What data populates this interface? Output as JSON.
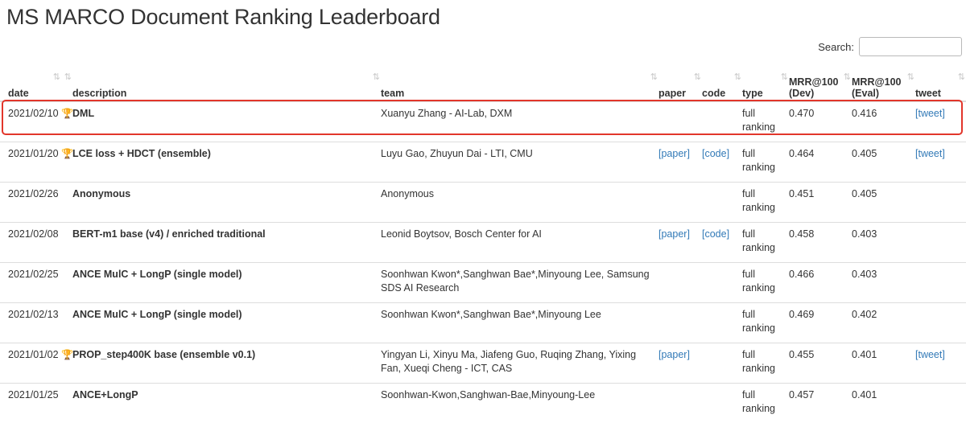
{
  "title": "MS MARCO Document Ranking Leaderboard",
  "search": {
    "label": "Search:",
    "value": "",
    "placeholder": ""
  },
  "columns": {
    "date": "date",
    "description": "description",
    "team": "team",
    "paper": "paper",
    "code": "code",
    "type": "type",
    "mrr_dev_1": "MRR@100",
    "mrr_dev_2": "(Dev)",
    "mrr_eval_1": "MRR@100",
    "mrr_eval_2": "(Eval)",
    "tweet": "tweet"
  },
  "sort_icon": "⇅",
  "rows": [
    {
      "date": "2021/02/10",
      "trophy": true,
      "description": "DML",
      "team": "Xuanyu Zhang - AI-Lab, DXM",
      "paper": "",
      "code": "",
      "type_1": "full",
      "type_2": "ranking",
      "dev": "0.470",
      "eval": "0.416",
      "tweet": "[tweet]"
    },
    {
      "date": "2021/01/20",
      "trophy": true,
      "description": "LCE loss + HDCT (ensemble)",
      "team": "Luyu Gao, Zhuyun Dai - LTI, CMU",
      "paper": "[paper]",
      "code": "[code]",
      "type_1": "full",
      "type_2": "ranking",
      "dev": "0.464",
      "eval": "0.405",
      "tweet": "[tweet]"
    },
    {
      "date": "2021/02/26",
      "trophy": false,
      "description": "Anonymous",
      "team": "Anonymous",
      "paper": "",
      "code": "",
      "type_1": "full",
      "type_2": "ranking",
      "dev": "0.451",
      "eval": "0.405",
      "tweet": ""
    },
    {
      "date": "2021/02/08",
      "trophy": false,
      "description": "BERT-m1 base (v4) / enriched traditional",
      "team": "Leonid Boytsov, Bosch Center for AI",
      "paper": "[paper]",
      "code": "[code]",
      "type_1": "full",
      "type_2": "ranking",
      "dev": "0.458",
      "eval": "0.403",
      "tweet": ""
    },
    {
      "date": "2021/02/25",
      "trophy": false,
      "description": "ANCE MulC + LongP (single model)",
      "team": "Soonhwan Kwon*,Sanghwan Bae*,Minyoung Lee, Samsung SDS AI Research",
      "paper": "",
      "code": "",
      "type_1": "full",
      "type_2": "ranking",
      "dev": "0.466",
      "eval": "0.403",
      "tweet": ""
    },
    {
      "date": "2021/02/13",
      "trophy": false,
      "description": "ANCE MulC + LongP (single model)",
      "team": "Soonhwan Kwon*,Sanghwan Bae*,Minyoung Lee",
      "paper": "",
      "code": "",
      "type_1": "full",
      "type_2": "ranking",
      "dev": "0.469",
      "eval": "0.402",
      "tweet": ""
    },
    {
      "date": "2021/01/02",
      "trophy": true,
      "description": "PROP_step400K base (ensemble v0.1)",
      "team": "Yingyan Li, Xinyu Ma, Jiafeng Guo, Ruqing Zhang, Yixing Fan, Xueqi Cheng - ICT, CAS",
      "paper": "[paper]",
      "code": "",
      "type_1": "full",
      "type_2": "ranking",
      "dev": "0.455",
      "eval": "0.401",
      "tweet": "[tweet]"
    },
    {
      "date": "2021/01/25",
      "trophy": false,
      "description": "ANCE+LongP",
      "team": "Soonhwan-Kwon,Sanghwan-Bae,Minyoung-Lee",
      "paper": "",
      "code": "",
      "type_1": "full",
      "type_2": "ranking",
      "dev": "0.457",
      "eval": "0.401",
      "tweet": ""
    }
  ]
}
